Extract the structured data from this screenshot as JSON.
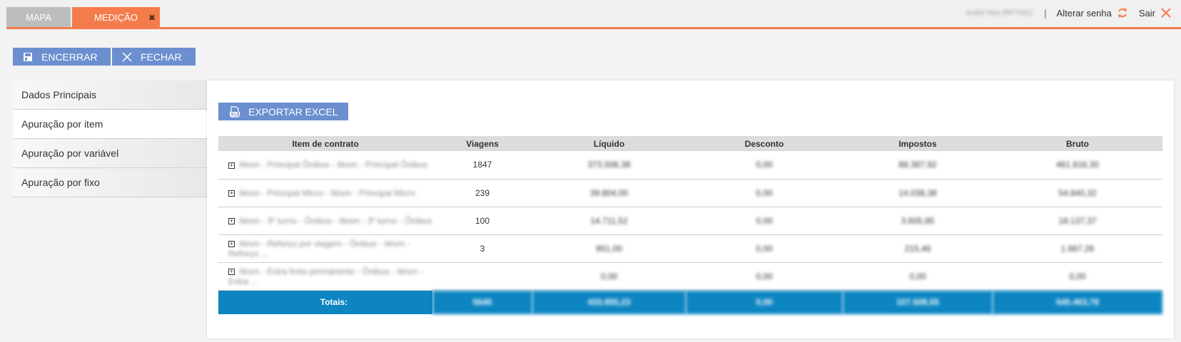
{
  "tabs": [
    {
      "label": "MAPA",
      "active": false
    },
    {
      "label": "MEDIÇÃO",
      "active": true,
      "close_glyph": "✖"
    }
  ],
  "user": {
    "name": "André Neo (RFT451)",
    "separator": "|",
    "change_password_label": "Alterar senha",
    "logout_label": "Sair"
  },
  "toolbar": {
    "encerrar_label": "ENCERRAR",
    "fechar_label": "FECHAR"
  },
  "sidebar": {
    "items": [
      {
        "label": "Dados Principais"
      },
      {
        "label": "Apuração por item"
      },
      {
        "label": "Apuração por variável"
      },
      {
        "label": "Apuração por fixo"
      }
    ],
    "active_index": 1
  },
  "content": {
    "export_label": "EXPORTAR EXCEL",
    "table": {
      "columns": [
        "Item de contrato",
        "Viagens",
        "Líquido",
        "Desconto",
        "Impostos",
        "Bruto"
      ],
      "rows": [
        {
          "item": "Ilésm - Principal Ônibus - Ilésm - Principal Ônibus",
          "viagens": "1847",
          "liquido": "373.508,38",
          "desconto": "0,00",
          "impostos": "88.387,92",
          "bruto": "461.816,30"
        },
        {
          "item": "Ilésm - Principal Micro - Ilésm - Principal Micro",
          "viagens": "239",
          "liquido": "39.804,00",
          "desconto": "0,00",
          "impostos": "14.038,38",
          "bruto": "54.840,32"
        },
        {
          "item": "Ilésm - 3º turno - Ônibus - Ilésm - 3º turno - Ônibus",
          "viagens": "100",
          "liquido": "14.711,52",
          "desconto": "0,00",
          "impostos": "3.605,85",
          "bruto": "18.137,37"
        },
        {
          "item": "Ilésm - Reforço por viagem - Ônibus - Ilésm - Reforço ...",
          "viagens": "3",
          "liquido": "951,00",
          "desconto": "0,00",
          "impostos": "215,46",
          "bruto": "1.667,26"
        },
        {
          "item": "Ilésm - Extra frota permanente - Ônibus - Ilésm - Extra ...",
          "viagens": "",
          "liquido": "0,00",
          "desconto": "0,00",
          "impostos": "0,00",
          "bruto": "0,00"
        }
      ],
      "totals": {
        "label": "Totais:",
        "viagens": "5645",
        "liquido": "433.855,23",
        "desconto": "0,00",
        "impostos": "107.508,55",
        "bruto": "545.463,78"
      }
    }
  },
  "colors": {
    "accent": "#f47c4b",
    "button": "#6b8fcf",
    "totals_bar": "#0c85c1"
  },
  "icons": [
    "close-icon",
    "refresh-icon",
    "logout-x-icon",
    "save-icon",
    "close-x-icon",
    "xls-icon",
    "expand-plus-icon"
  ]
}
